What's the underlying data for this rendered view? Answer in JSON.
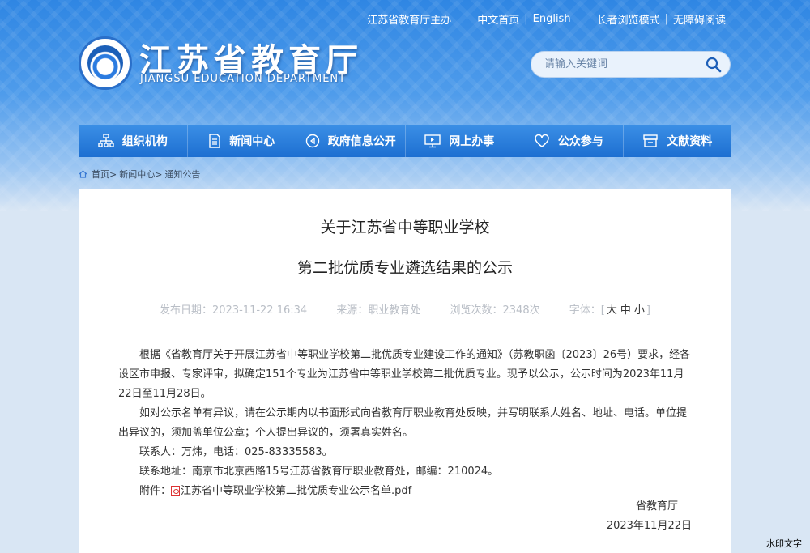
{
  "header": {
    "top_links": [
      "江苏省教育厅主办",
      "中文首页",
      "English",
      "长者浏览模式",
      "无障碍阅读"
    ],
    "site_title": "江苏省教育厅",
    "site_subtitle": "JIANGSU EDUCATION DEPARTMENT",
    "search_placeholder": "请输入关键词"
  },
  "nav": [
    {
      "label": "组织机构",
      "icon": "org-chart-icon"
    },
    {
      "label": "新闻中心",
      "icon": "document-icon"
    },
    {
      "label": "政府信息公开",
      "icon": "compass-icon"
    },
    {
      "label": "网上办事",
      "icon": "monitor-icon"
    },
    {
      "label": "公众参与",
      "icon": "heart-icon"
    },
    {
      "label": "文献资料",
      "icon": "archive-icon"
    }
  ],
  "breadcrumb": {
    "home": "首页",
    "news": "新闻中心",
    "notice": "通知公告"
  },
  "article": {
    "title_line1": "关于江苏省中等职业学校",
    "title_line2": "第二批优质专业遴选结果的公示",
    "publish_date_label": "发布日期：",
    "publish_date": "2023-11-22 16:34",
    "source_label": "来源：",
    "source": "职业教育处",
    "views_label": "浏览次数：",
    "views": "2348次",
    "font_label": "字体：",
    "font_large": "大",
    "font_medium": "中",
    "font_small": "小",
    "para1": "根据《省教育厅关于开展江苏省中等职业学校第二批优质专业建设工作的通知》（苏教职函〔2023〕26号）要求，经各设区市申报、专家评审，拟确定151个专业为江苏省中等职业学校第二批优质专业。现予以公示，公示时间为2023年11月22日至11月28日。",
    "para2": "如对公示名单有异议，请在公示期内以书面形式向省教育厅职业教育处反映，并写明联系人姓名、地址、电话。单位提出异议的，须加盖单位公章；个人提出异议的，须署真实姓名。",
    "contact": "联系人：万炜，电话：025-83335583。",
    "address": "联系地址：南京市北京西路15号江苏省教育厅职业教育处，邮编：210024。",
    "attachment_label": "附件：",
    "attachment_file": "江苏省中等职业学校第二批优质专业公示名单.pdf",
    "signature": "省教育厅",
    "sign_date": "2023年11月22日"
  },
  "watermark": "水印文字"
}
